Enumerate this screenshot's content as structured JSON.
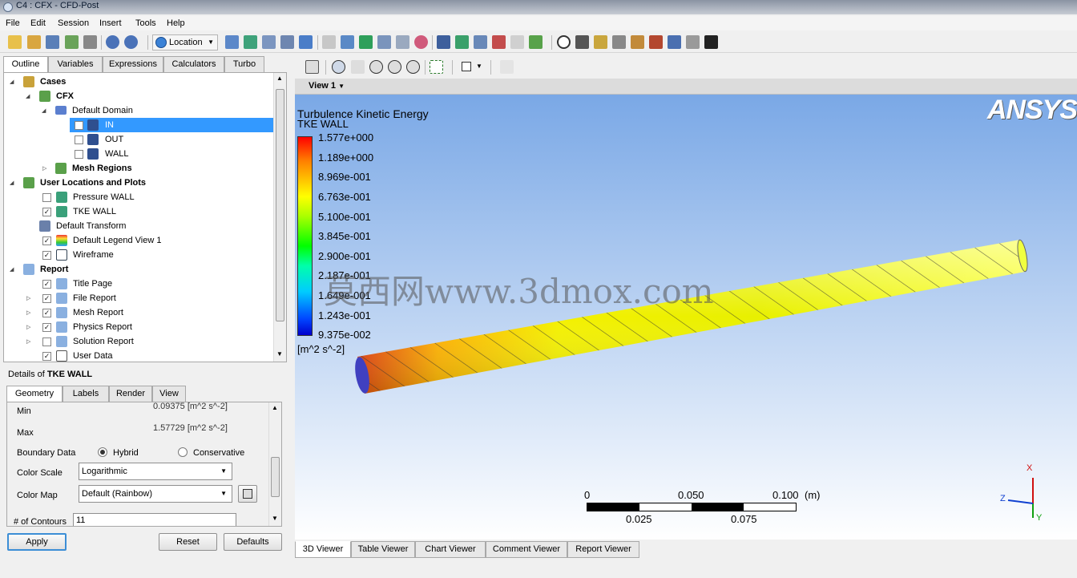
{
  "window": {
    "title": "C4 : CFX - CFD-Post"
  },
  "menu": [
    "File",
    "Edit",
    "Session",
    "Insert",
    "Tools",
    "Help"
  ],
  "toolbar": {
    "location_label": "Location"
  },
  "panel_tabs": [
    "Outline",
    "Variables",
    "Expressions",
    "Calculators",
    "Turbo"
  ],
  "tree": [
    {
      "label": "Cases",
      "bold": true
    },
    {
      "label": "CFX",
      "bold": true
    },
    {
      "label": "Default Domain"
    },
    {
      "label": "IN",
      "selected": true
    },
    {
      "label": "OUT"
    },
    {
      "label": "WALL"
    },
    {
      "label": "Mesh Regions",
      "bold": true
    },
    {
      "label": "User Locations and Plots",
      "bold": true
    },
    {
      "label": "Pressure WALL"
    },
    {
      "label": "TKE WALL"
    },
    {
      "label": "Default Transform"
    },
    {
      "label": "Default Legend View 1"
    },
    {
      "label": "Wireframe"
    },
    {
      "label": "Report",
      "bold": true
    },
    {
      "label": "Title Page"
    },
    {
      "label": "File Report"
    },
    {
      "label": "Mesh Report"
    },
    {
      "label": "Physics Report"
    },
    {
      "label": "Solution Report"
    },
    {
      "label": "User Data"
    }
  ],
  "details": {
    "prefix": "Details of ",
    "object": "TKE WALL",
    "tabs": [
      "Geometry",
      "Labels",
      "Render",
      "View"
    ],
    "min_label": "Min",
    "min_value": "0.09375 [m^2 s^-2]",
    "max_label": "Max",
    "max_value": "1.57729 [m^2 s^-2]",
    "boundary_label": "Boundary Data",
    "boundary_options": [
      "Hybrid",
      "Conservative"
    ],
    "color_scale_label": "Color Scale",
    "color_scale_value": "Logarithmic",
    "color_map_label": "Color Map",
    "color_map_value": "Default (Rainbow)",
    "contours_label": "# of Contours",
    "contours_value": "11"
  },
  "buttons": {
    "apply": "Apply",
    "reset": "Reset",
    "defaults": "Defaults"
  },
  "viewer": {
    "view_name": "View 1",
    "brand": "ANSYS",
    "legend_title": "Turbulence Kinetic Energy",
    "legend_subtitle": "TKE WALL",
    "legend_values": [
      "1.577e+000",
      "1.189e+000",
      "8.969e-001",
      "6.763e-001",
      "5.100e-001",
      "3.845e-001",
      "2.900e-001",
      "2.187e-001",
      "1.649e-001",
      "1.243e-001",
      "9.375e-002"
    ],
    "legend_unit": "[m^2 s^-2]",
    "scale_top": [
      "0",
      "0.050",
      "0.100"
    ],
    "scale_unit": "(m)",
    "scale_bottom": [
      "0.025",
      "0.075"
    ],
    "axis_labels": [
      "X",
      "Y",
      "Z"
    ],
    "watermark": "莫西网www.3dmox.com"
  },
  "viewer_tabs": [
    "3D Viewer",
    "Table Viewer",
    "Chart Viewer",
    "Comment Viewer",
    "Report Viewer"
  ]
}
